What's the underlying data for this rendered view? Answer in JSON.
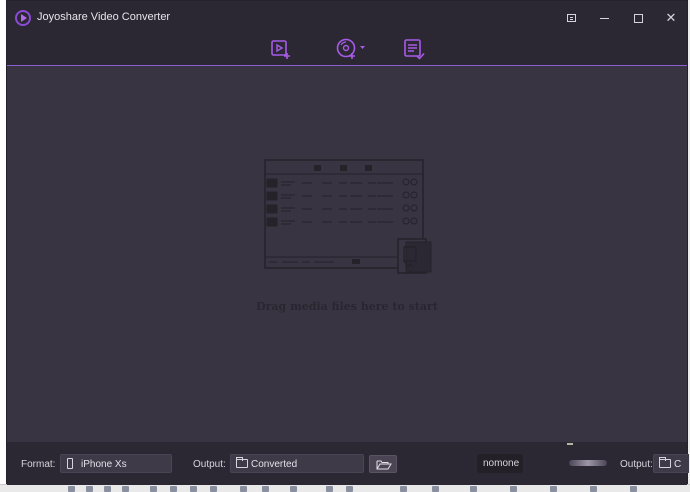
{
  "window": {
    "title": "Joyoshare Video Converter",
    "close_glyph": "✕"
  },
  "toolbar": {
    "items": [
      {
        "name": "add-files-icon"
      },
      {
        "name": "load-dvd-icon"
      },
      {
        "name": "history-list-icon"
      }
    ]
  },
  "main": {
    "drop_hint": "Drag media files here to start"
  },
  "bottom": {
    "format_label": "Format:",
    "format_value": "iPhone Xs",
    "output_label": "Output:",
    "output_value": "Converted",
    "ghost_text": "nomone",
    "output2_label": "Output:",
    "output2_value": "C"
  },
  "colors": {
    "accent": "#8b5fd0",
    "window_bg": "#393442",
    "bar_bg": "#2c2833"
  }
}
